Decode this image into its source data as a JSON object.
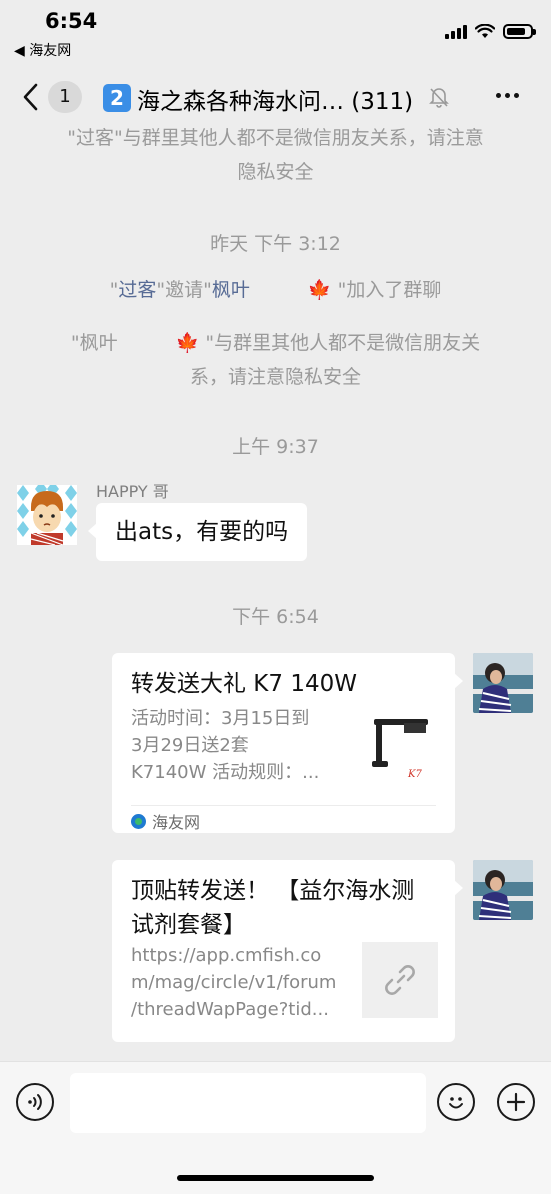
{
  "status_bar": {
    "time": "6:54",
    "back_app": "◀ 海友网"
  },
  "nav": {
    "unread_count": "1",
    "title_number": "2",
    "title": "海之森各种海水问… (311)"
  },
  "system_messages": {
    "msg1_line1": "\"过客\"与群里其他人都不是微信朋友关系，请注意",
    "msg1_line2": "隐私安全",
    "time1": "昨天 下午 3:12",
    "invite": {
      "q1": "\"",
      "inviter": "过客",
      "mid": "\"邀请\"",
      "invitee": "枫叶",
      "leaf": "🍁",
      "end": "\"加入了群聊"
    },
    "notice2": {
      "q1": "\"",
      "name": "枫叶",
      "leaf": "🍁",
      "line1_end": "\"与群里其他人都不是微信朋友关",
      "line2": "系，请注意隐私安全"
    },
    "time2": "上午 9:37",
    "time3": "下午 6:54"
  },
  "messages": {
    "happy": {
      "sender": "HAPPY 哥",
      "text": "出ats，有要的吗"
    },
    "card1": {
      "title": "转发送大礼  K7 140W",
      "desc_line1": "活动时间：3月15日到",
      "desc_line2": "3月29日送2套",
      "desc_line3": "K7140W 活动规则：...",
      "source": "海友网",
      "thumb_text": "K7"
    },
    "card2": {
      "title_line1": "顶贴转发送！ 【益尔海水测",
      "title_line2": "试剂套餐】",
      "desc_line1": "https://app.cmfish.co",
      "desc_line2": "m/mag/circle/v1/forum",
      "desc_line3": "/threadWapPage?tid..."
    }
  },
  "input_bar": {
    "placeholder": ""
  },
  "colors": {
    "background": "#ededed",
    "link_blue": "#576b95",
    "badge_blue": "#3a8ee6"
  }
}
